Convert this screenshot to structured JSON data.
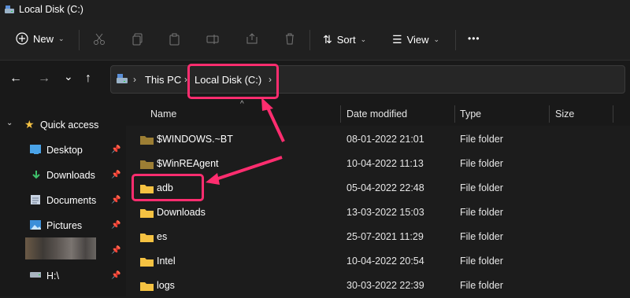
{
  "window": {
    "title": "Local Disk (C:)"
  },
  "toolbar": {
    "new_label": "New",
    "sort_label": "Sort",
    "view_label": "View",
    "more_label": "•••"
  },
  "address": {
    "crumbs": [
      "This PC",
      "Local Disk (C:)"
    ]
  },
  "sidebar": {
    "quick_access": "Quick access",
    "items": [
      {
        "label": "Desktop",
        "icon": "desktop-icon"
      },
      {
        "label": "Downloads",
        "icon": "download-icon"
      },
      {
        "label": "Documents",
        "icon": "documents-icon"
      },
      {
        "label": "Pictures",
        "icon": "pictures-icon"
      },
      {
        "label": "",
        "icon": "blurred-folder-icon"
      },
      {
        "label": "H:\\",
        "icon": "drive-icon"
      }
    ]
  },
  "columns": {
    "name": "Name",
    "date": "Date modified",
    "type": "Type",
    "size": "Size"
  },
  "files": [
    {
      "name": "$WINDOWS.~BT",
      "date": "08-01-2022 21:01",
      "type": "File folder",
      "hidden": true
    },
    {
      "name": "$WinREAgent",
      "date": "10-04-2022 11:13",
      "type": "File folder",
      "hidden": true
    },
    {
      "name": "adb",
      "date": "05-04-2022 22:48",
      "type": "File folder",
      "hidden": false
    },
    {
      "name": "Downloads",
      "date": "13-03-2022 15:03",
      "type": "File folder",
      "hidden": false
    },
    {
      "name": "es",
      "date": "25-07-2021 11:29",
      "type": "File folder",
      "hidden": false
    },
    {
      "name": "Intel",
      "date": "10-04-2022 20:54",
      "type": "File folder",
      "hidden": false
    },
    {
      "name": "logs",
      "date": "30-03-2022 22:39",
      "type": "File folder",
      "hidden": false
    }
  ],
  "colors": {
    "accent": "#ff2d6f",
    "folder": "#f5c242",
    "folder_hidden": "#9c7e34"
  }
}
